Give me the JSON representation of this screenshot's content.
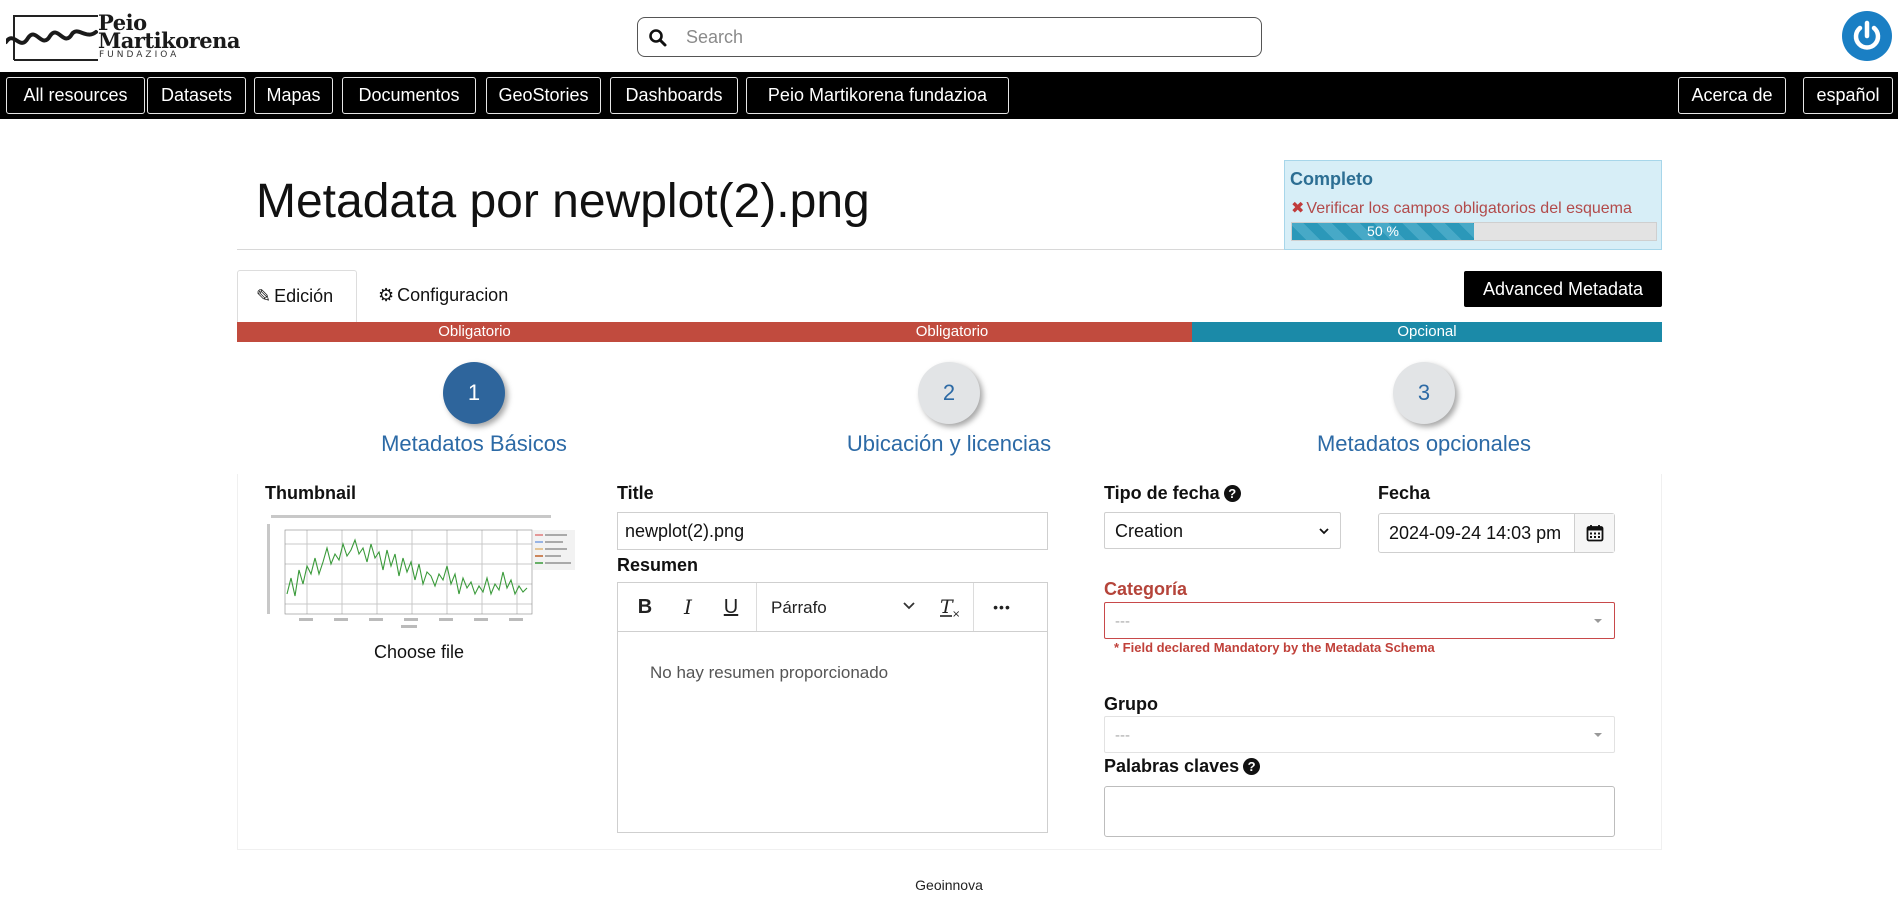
{
  "header": {
    "logo": {
      "line1": "Peio",
      "line2": "Martikorena",
      "line3": "FUNDAZIOA"
    },
    "search": {
      "placeholder": "Search",
      "value": ""
    },
    "icons": {
      "search": "search-icon",
      "account": "power-icon"
    }
  },
  "nav": {
    "left": [
      "All resources",
      "Datasets",
      "Mapas",
      "Documentos",
      "GeoStories",
      "Dashboards",
      "Peio Martikorena fundazioa"
    ],
    "right": [
      "Acerca de",
      "español"
    ]
  },
  "page": {
    "title": "Metadata por newplot(2).png"
  },
  "completeness": {
    "title": "Completo",
    "error": "Verificar los campos obligatorios del esquema",
    "progress_text": "50 %",
    "progress_value": 0.5
  },
  "tabs": {
    "edit": "Edición",
    "config": "Configuracion",
    "advanced": "Advanced Metadata"
  },
  "steps": {
    "bar": [
      "Obligatorio",
      "Obligatorio",
      "Opcional"
    ],
    "items": [
      {
        "number": "1",
        "label": "Metadatos Básicos"
      },
      {
        "number": "2",
        "label": "Ubicación y licencias"
      },
      {
        "number": "3",
        "label": "Metadatos opcionales"
      }
    ]
  },
  "form": {
    "thumbnail_label": "Thumbnail",
    "choose_file": "Choose file",
    "title_label": "Title",
    "title_value": "newplot(2).png",
    "abstract_label": "Resumen",
    "editor": {
      "bold": "B",
      "italic": "I",
      "underline": "U",
      "format": "Párrafo",
      "more": "•••",
      "placeholder": "No hay resumen proporcionado"
    },
    "date_type_label": "Tipo de fecha",
    "date_type_value": "Creation",
    "date_label": "Fecha",
    "date_value": "2024-09-24 14:03 pm",
    "category_label": "Categoría",
    "category_value": "---",
    "mandatory_note": "* Field declared Mandatory by the Metadata Schema",
    "group_label": "Grupo",
    "group_value": "---",
    "keywords_label": "Palabras claves"
  },
  "footer": {
    "text": "Geoinnova"
  },
  "colors": {
    "nav_bg": "#000000",
    "required": "#c14b3e",
    "optional": "#1b8aa8",
    "step_current": "#2e659c",
    "link_blue": "#2c6aa6",
    "error_red": "#c0413a"
  }
}
